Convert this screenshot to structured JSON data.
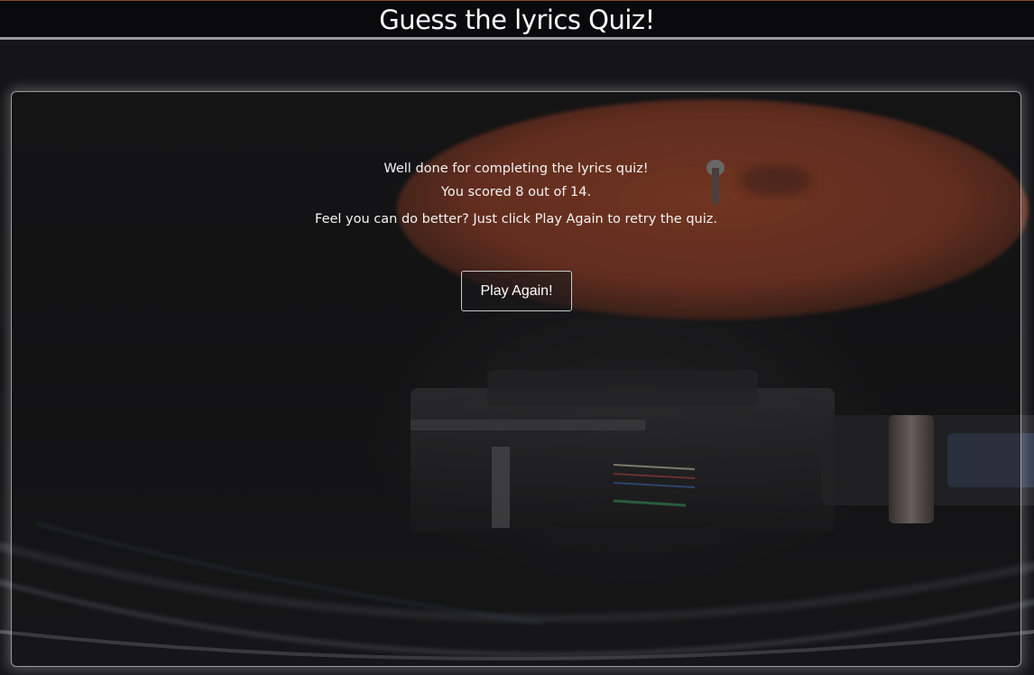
{
  "header": {
    "title": "Guess the lyrics Quiz!"
  },
  "results": {
    "completion_message": "Well done for completing the lyrics quiz!",
    "score_message": "You scored 8 out of 14.",
    "retry_message": "Feel you can do better? Just click Play Again to retry the quiz."
  },
  "actions": {
    "play_again_label": "Play Again!"
  },
  "colors": {
    "header_accent": "#8a4a20",
    "record_label_orange": "#b24a2a",
    "text": "#f4f4f4"
  }
}
